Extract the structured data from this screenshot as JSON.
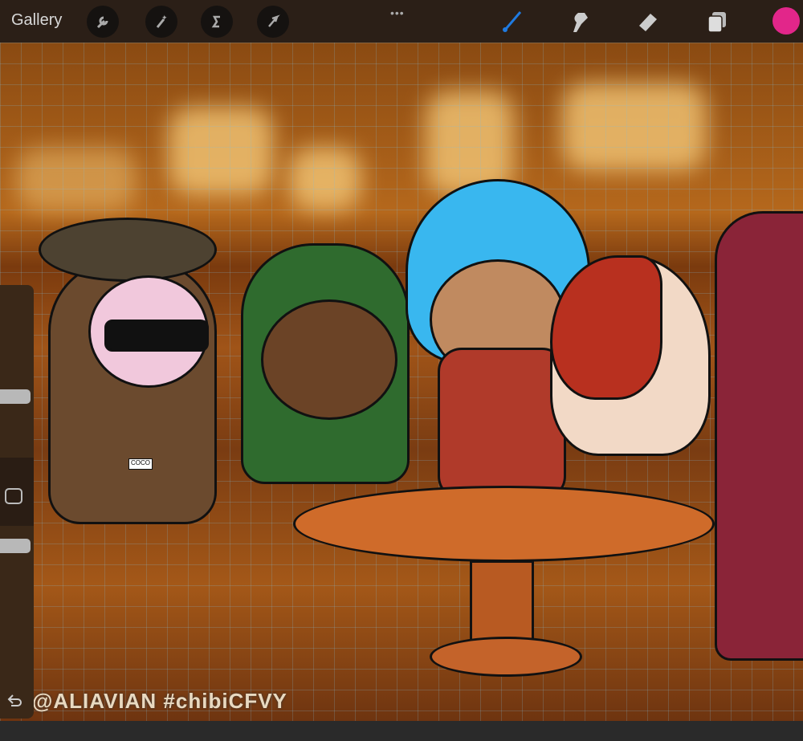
{
  "topbar": {
    "gallery_label": "Gallery",
    "more_label": "•••",
    "left_tools": [
      "wrench-icon",
      "magic-wand-icon",
      "selection-icon",
      "transform-arrow-icon"
    ],
    "right_tools": [
      "brush-icon",
      "smudge-icon",
      "eraser-icon",
      "layers-icon"
    ],
    "current_color": "#e2268a",
    "brush_color": "#1f7ae0"
  },
  "canvas": {
    "watermark": "@ALIAVIAN #chibiCFVY",
    "name_tag": "COCO"
  },
  "sidebar": {
    "tools": [
      "brush-size-slider",
      "modify-button",
      "opacity-slider",
      "undo-button"
    ]
  }
}
